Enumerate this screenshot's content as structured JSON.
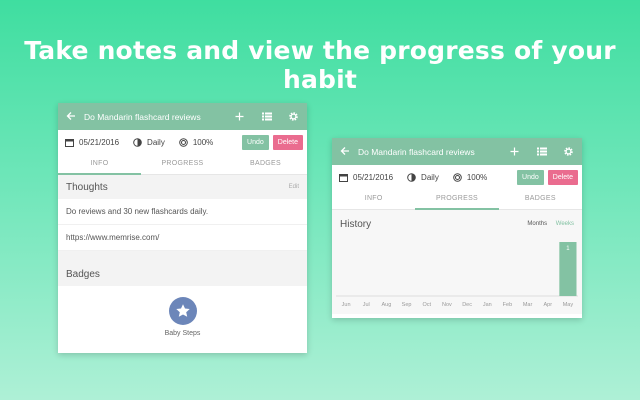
{
  "headline": "Take notes and view the progress of your habit",
  "habit": {
    "title": "Do Mandarin flashcard reviews",
    "date": "05/21/2016",
    "frequency": "Daily",
    "percent": "100%",
    "undo_label": "Undo",
    "delete_label": "Delete"
  },
  "tabs": [
    "INFO",
    "PROGRESS",
    "BADGES"
  ],
  "info_card": {
    "active_tab": 0,
    "thoughts_heading": "Thoughts",
    "edit_label": "Edit",
    "notes": [
      "Do reviews and 30 new flashcards daily.",
      "https://www.memrise.com/"
    ],
    "badges_heading": "Badges",
    "badge_name": "Baby Steps"
  },
  "progress_card": {
    "active_tab": 1,
    "history_heading": "History",
    "view_options": [
      "Months",
      "Weeks"
    ],
    "selected_view": "Weeks"
  },
  "colors": {
    "accent": "#83c2a3",
    "delete": "#ea6c8f",
    "badge": "#6c86b9"
  },
  "icons": [
    "back-arrow-icon",
    "add-icon",
    "list-icon",
    "gear-icon",
    "calendar-icon",
    "frequency-icon",
    "progress-icon",
    "star-icon"
  ],
  "chart_data": {
    "type": "bar",
    "categories": [
      "Jun",
      "Jul",
      "Aug",
      "Sep",
      "Oct",
      "Nov",
      "Dec",
      "Jan",
      "Feb",
      "Mar",
      "Apr",
      "May"
    ],
    "values": [
      0,
      0,
      0,
      0,
      0,
      0,
      0,
      0,
      0,
      0,
      0,
      1
    ],
    "data_labels": [
      "",
      "",
      "",
      "",
      "",
      "",
      "",
      "",
      "",
      "",
      "",
      "1"
    ],
    "title": "History",
    "ylim": [
      0,
      1
    ]
  }
}
